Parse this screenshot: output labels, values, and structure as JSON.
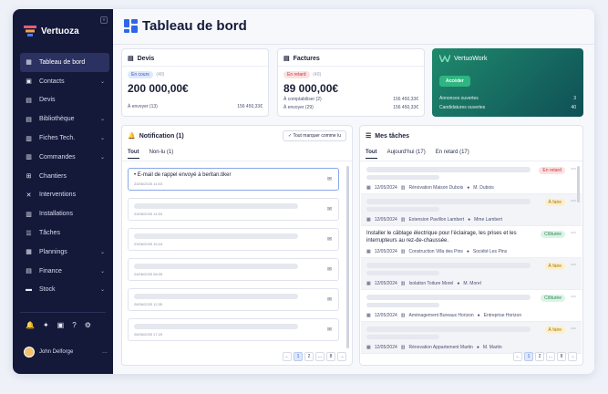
{
  "app": {
    "name": "Vertuoza",
    "collapse_symbol": "»"
  },
  "sidebar": {
    "items": [
      {
        "label": "Tableau de bord",
        "icon": "dashboard-icon",
        "glyph": "▦",
        "chev": ""
      },
      {
        "label": "Contacts",
        "icon": "contacts-icon",
        "glyph": "▣",
        "chev": "⌄"
      },
      {
        "label": "Devis",
        "icon": "devis-icon",
        "glyph": "▤",
        "chev": ""
      },
      {
        "label": "Bibliothèque",
        "icon": "library-icon",
        "glyph": "▤",
        "chev": "⌄"
      },
      {
        "label": "Fiches Tech.",
        "icon": "tech-sheet-icon",
        "glyph": "▥",
        "chev": "⌄"
      },
      {
        "label": "Commandes",
        "icon": "orders-icon",
        "glyph": "▥",
        "chev": "⌄"
      },
      {
        "label": "Chantiers",
        "icon": "worksite-icon",
        "glyph": "⊞",
        "chev": ""
      },
      {
        "label": "Interventions",
        "icon": "tools-icon",
        "glyph": "✕",
        "chev": ""
      },
      {
        "label": "Installations",
        "icon": "installations-icon",
        "glyph": "▥",
        "chev": ""
      },
      {
        "label": "Tâches",
        "icon": "tasks-icon",
        "glyph": "☰",
        "chev": ""
      },
      {
        "label": "Plannings",
        "icon": "calendar-icon",
        "glyph": "▦",
        "chev": "⌄"
      },
      {
        "label": "Finance",
        "icon": "finance-icon",
        "glyph": "▤",
        "chev": "⌄"
      },
      {
        "label": "Stock",
        "icon": "stock-icon",
        "glyph": "▬",
        "chev": "⌄"
      }
    ],
    "bottom_icons": [
      {
        "name": "bell-icon",
        "glyph": "🔔"
      },
      {
        "name": "sparkle-icon",
        "glyph": "✦"
      },
      {
        "name": "book-icon",
        "glyph": "▣"
      },
      {
        "name": "help-icon",
        "glyph": "?"
      },
      {
        "name": "settings-icon",
        "glyph": "⚙"
      }
    ],
    "user": {
      "name": "John Delforge",
      "more": "…"
    }
  },
  "page": {
    "title": "Tableau de bord"
  },
  "devis": {
    "title": "Devis",
    "badge": "En cours",
    "count": "(40)",
    "amount": "200 000,00€",
    "row_label": "À envoyer (13)",
    "row_value": "156 450,33€"
  },
  "factures": {
    "title": "Factures",
    "badge": "En retard",
    "count": "(40)",
    "amount": "89 000,00€",
    "rows": [
      {
        "label": "À comptabiliser (2)",
        "value": "156 450,33€"
      },
      {
        "label": "À envoyer (29)",
        "value": "156 450,33€"
      }
    ]
  },
  "vertuowork": {
    "title": "VertuoWork",
    "button": "Accéder",
    "rows": [
      {
        "label": "Annonces ouvertes",
        "value": "3"
      },
      {
        "label": "Candidatures ouvertes",
        "value": "40"
      }
    ],
    "colors": {
      "from": "#1f8a6c",
      "to": "#0f4f57"
    }
  },
  "notifications": {
    "title": "Notification (1)",
    "mark_all": "Tout marquer comme lu",
    "tabs": [
      "Tout",
      "Non-lu (1)"
    ],
    "items": [
      {
        "text": "E-mail de rappel envoyé à beritan.tiker",
        "date": "23/06/2025 14:03",
        "unread": true
      },
      {
        "text": "",
        "date": "23/06/2025 14:03",
        "unread": false
      },
      {
        "text": "",
        "date": "23/06/2025 15:24",
        "unread": false
      },
      {
        "text": "",
        "date": "24/06/2025 08:05",
        "unread": false
      },
      {
        "text": "",
        "date": "26/06/2025 12:35",
        "unread": false
      },
      {
        "text": "",
        "date": "26/06/2025 17:20",
        "unread": false
      }
    ],
    "pager": {
      "prev": "←",
      "pages": [
        "1",
        "2",
        "...",
        "8"
      ],
      "next": "→",
      "current": "1"
    }
  },
  "tasks": {
    "title": "Mes tâches",
    "tabs": [
      "Tout",
      "Aujourd'hui (17)",
      "En retard (17)"
    ],
    "items": [
      {
        "text": "",
        "status": "En retard",
        "status_class": "b-red",
        "date": "12/05/2024",
        "project": "Rénovation Maison Dubois",
        "person": "M. Dubois",
        "alt": false
      },
      {
        "text": "",
        "status": "À faire",
        "status_class": "b-yel",
        "date": "12/05/2024",
        "project": "Extension Pavillon Lambert",
        "person": "Mme Lambert",
        "alt": true
      },
      {
        "text": "Installer le câblage électrique pour l'éclairage, les prises et les interrupteurs au rez-de-chaussée.",
        "status": "Clôturée",
        "status_class": "b-green",
        "date": "12/05/2024",
        "project": "Construction Villa des Pins",
        "person": "Société Les Pins",
        "alt": false
      },
      {
        "text": "",
        "status": "À faire",
        "status_class": "b-yel",
        "date": "12/05/2024",
        "project": "Isolation Toiture Morel",
        "person": "M. Morel",
        "alt": true
      },
      {
        "text": "",
        "status": "Clôturée",
        "status_class": "b-green",
        "date": "12/05/2024",
        "project": "Aménagement Bureaux Horizon",
        "person": "Entreprise Horizon",
        "alt": false
      },
      {
        "text": "",
        "status": "À faire",
        "status_class": "b-yel",
        "date": "12/05/2024",
        "project": "Rénovation Appartement Martin",
        "person": "M. Martin",
        "alt": true
      }
    ],
    "pager": {
      "prev": "←",
      "pages": [
        "1",
        "2",
        "...",
        "8"
      ],
      "next": "→",
      "current": "1"
    }
  }
}
